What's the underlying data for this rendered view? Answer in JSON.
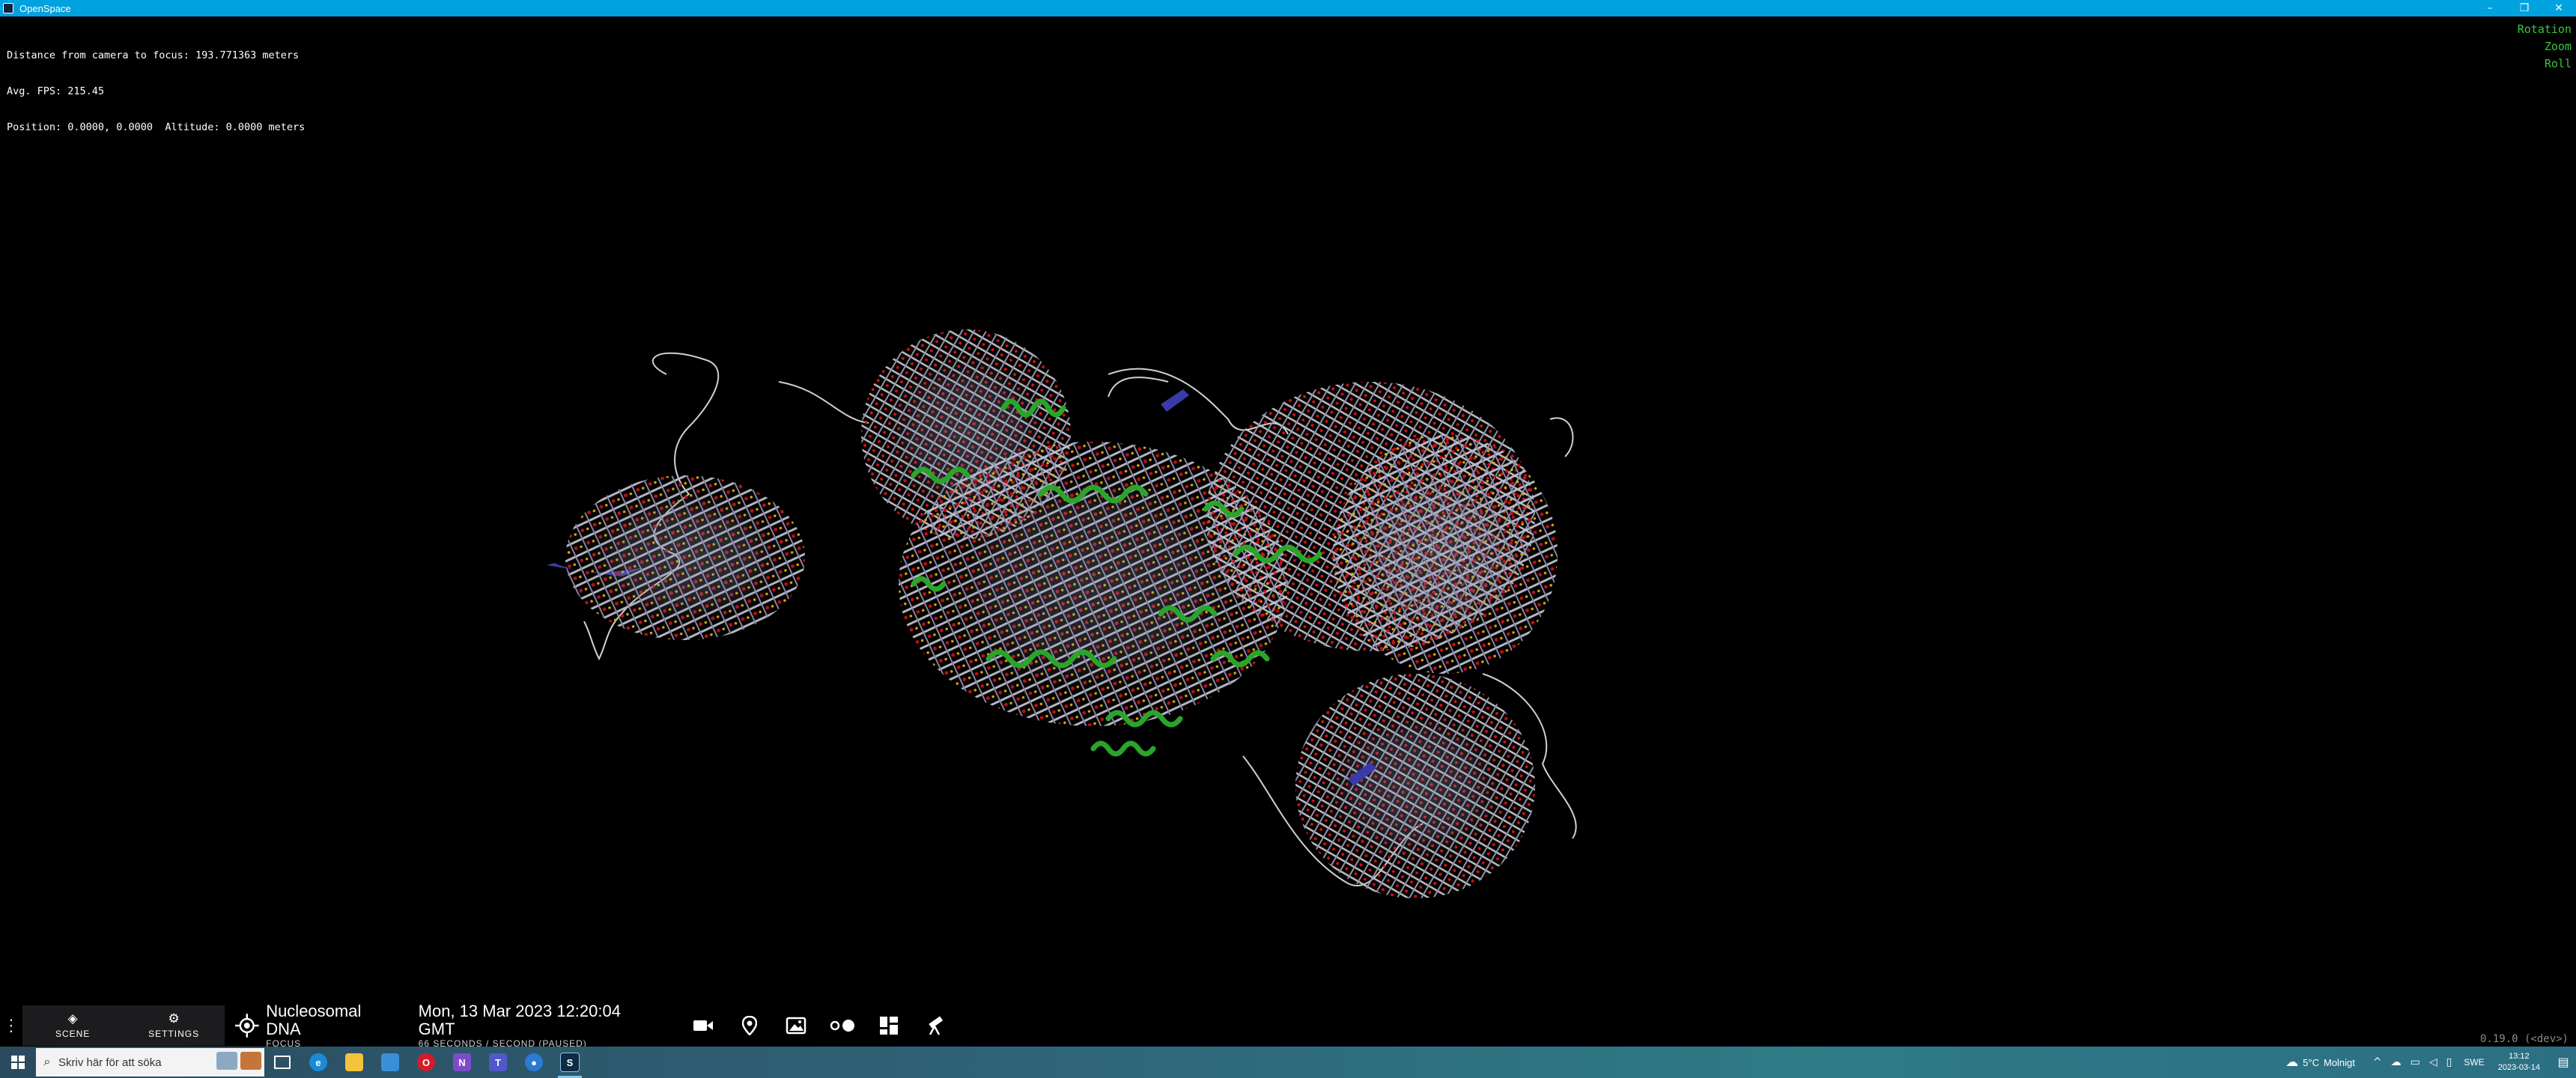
{
  "window": {
    "title": "OpenSpace",
    "controls": [
      "–",
      "❐",
      "✕"
    ]
  },
  "info": {
    "distance": "Distance from camera to focus: 193.771363 meters",
    "fps": "Avg. FPS: 215.45",
    "position": "Position: 0.0000, 0.0000  Altitude: 0.0000 meters"
  },
  "navigation_hints": {
    "rotation": "Rotation",
    "zoom": "Zoom",
    "roll": "Roll",
    "color": "#39c83a"
  },
  "version": "0.19.0 (<dev>)",
  "bottom_bar": {
    "menu_icon": "kebab-icon",
    "scene_label": "SCENE",
    "settings_label": "SETTINGS",
    "focus_name": "Nucleosomal DNA",
    "focus_label": "FOCUS",
    "date_time": "Mon, 13 Mar 2023 12:20:04 GMT",
    "time_rate": "66 SECONDS / SECOND (PAUSED)",
    "tools": [
      "camera-icon",
      "location-pin-icon",
      "image-icon",
      "toggle-icon",
      "dashboard-icon",
      "telescope-icon"
    ]
  },
  "taskbar": {
    "search_placeholder": "Skriv här för att söka",
    "apps": [
      "task-view-icon",
      "edge-icon",
      "file-explorer-icon",
      "store-icon",
      "opera-icon",
      "visual-studio-icon",
      "teams-icon",
      "maps-icon",
      "openspace-icon"
    ],
    "weather_temp": "5°C",
    "weather_text": "Molnigt",
    "language": "SWE",
    "time": "13:12",
    "date": "2023-03-14"
  },
  "colors": {
    "titlebar": "#00a2e0",
    "helix_green": "#2aa52a",
    "strand_blue": "#3a3aa8"
  }
}
